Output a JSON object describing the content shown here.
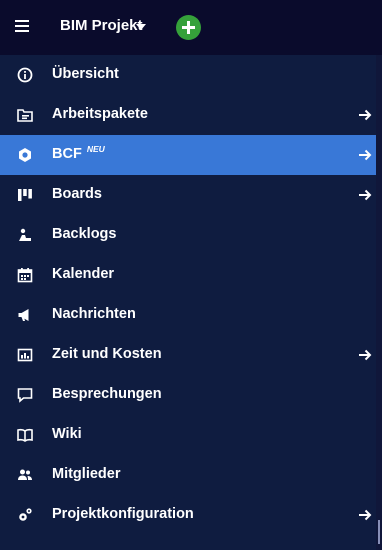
{
  "header": {
    "project_name": "BIM Projekt"
  },
  "menu": {
    "items": [
      {
        "label": "Übersicht",
        "icon": "info-icon",
        "has_arrow": false
      },
      {
        "label": "Arbeitspakete",
        "icon": "work-packages-icon",
        "has_arrow": true
      },
      {
        "label": "BCF",
        "badge": "NEU",
        "icon": "bcf-icon",
        "has_arrow": true,
        "active": true
      },
      {
        "label": "Boards",
        "icon": "boards-icon",
        "has_arrow": true
      },
      {
        "label": "Backlogs",
        "icon": "backlogs-icon",
        "has_arrow": false
      },
      {
        "label": "Kalender",
        "icon": "calendar-icon",
        "has_arrow": false
      },
      {
        "label": "Nachrichten",
        "icon": "megaphone-icon",
        "has_arrow": false
      },
      {
        "label": "Zeit und Kosten",
        "icon": "time-costs-icon",
        "has_arrow": true
      },
      {
        "label": "Besprechungen",
        "icon": "meetings-icon",
        "has_arrow": false
      },
      {
        "label": "Wiki",
        "icon": "wiki-icon",
        "has_arrow": false
      },
      {
        "label": "Mitglieder",
        "icon": "members-icon",
        "has_arrow": false
      },
      {
        "label": "Projektkonfiguration",
        "icon": "settings-icon",
        "has_arrow": true
      }
    ]
  },
  "colors": {
    "header_bg": "#0a0b2c",
    "menu_bg": "#0f1c40",
    "active_bg": "#3978d7",
    "add_button": "#35a13a"
  }
}
